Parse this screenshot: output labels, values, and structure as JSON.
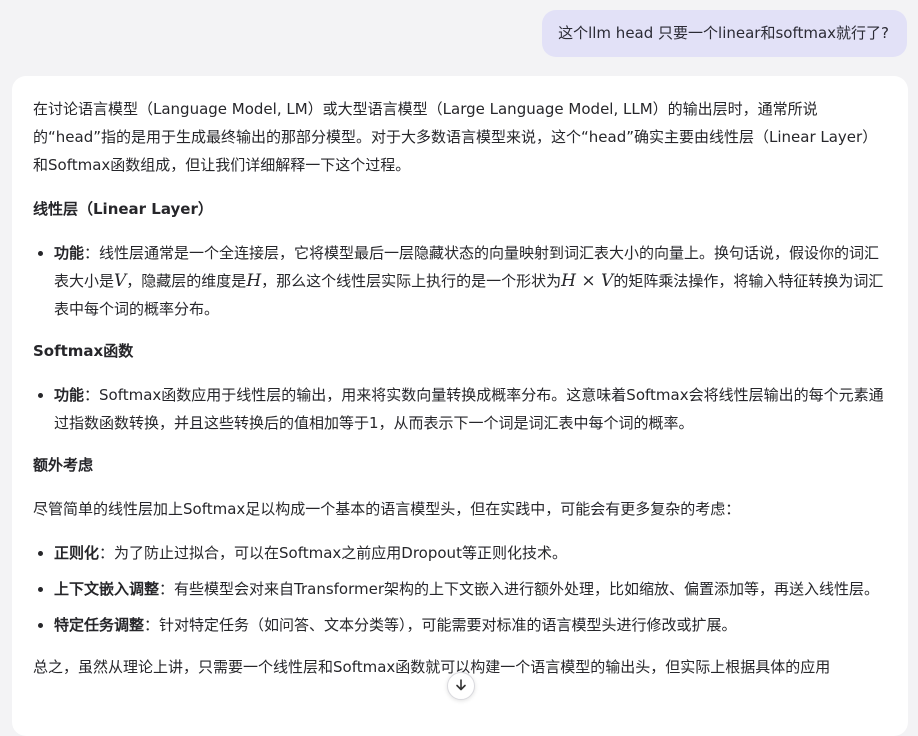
{
  "user_message": "这个llm head 只要一个linear和softmax就行了?",
  "answer": {
    "intro": "在讨论语言模型（Language Model, LM）或大型语言模型（Large Language Model, LLM）的输出层时，通常所说的“head”指的是用于生成最终输出的那部分模型。对于大多数语言模型来说，这个“head”确实主要由线性层（Linear Layer）和Softmax函数组成，但让我们详细解释一下这个过程。",
    "linear": {
      "heading": "线性层（Linear Layer）",
      "term": "功能",
      "text_a": "：线性层通常是一个全连接层，它将模型最后一层隐藏状态的向量映射到词汇表大小的向量上。换句话说，假设你的词汇表大小是",
      "var_v": "V",
      "text_b": "，隐藏层的维度是",
      "var_h": "H",
      "text_c": "，那么这个线性层实际上执行的是一个形状为",
      "shape": "H × V",
      "text_d": "的矩阵乘法操作，将输入特征转换为词汇表中每个词的概率分布。"
    },
    "softmax": {
      "heading": "Softmax函数",
      "term": "功能",
      "text": "：Softmax函数应用于线性层的输出，用来将实数向量转换成概率分布。这意味着Softmax会将线性层输出的每个元素通过指数函数转换，并且这些转换后的值相加等于1，从而表示下一个词是词汇表中每个词的概率。"
    },
    "extra": {
      "heading": "额外考虑",
      "intro": "尽管简单的线性层加上Softmax足以构成一个基本的语言模型头，但在实践中，可能会有更多复杂的考虑：",
      "items": [
        {
          "term": "正则化",
          "text": "：为了防止过拟合，可以在Softmax之前应用Dropout等正则化技术。"
        },
        {
          "term": "上下文嵌入调整",
          "text": "：有些模型会对来自Transformer架构的上下文嵌入进行额外处理，比如缩放、偏置添加等，再送入线性层。"
        },
        {
          "term": "特定任务调整",
          "text": "：针对特定任务（如问答、文本分类等），可能需要对标准的语言模型头进行修改或扩展。"
        }
      ]
    },
    "conclusion": "总之，虽然从理论上讲，只需要一个线性层和Softmax函数就可以构建一个语言模型的输出头，但实际上根据具体的应用"
  }
}
